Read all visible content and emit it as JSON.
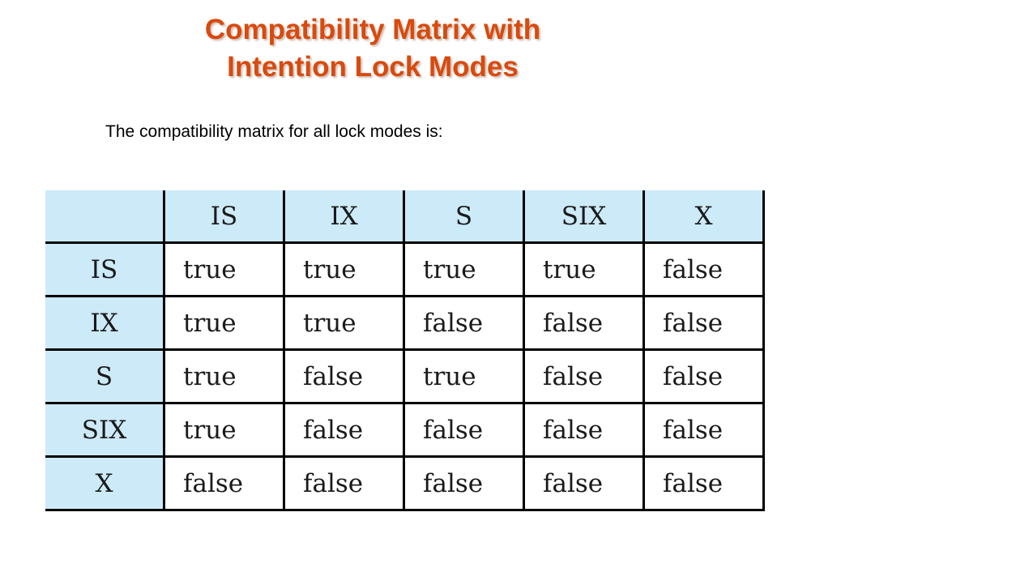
{
  "title": {
    "line1": "Compatibility Matrix with",
    "line2": "Intention Lock Modes"
  },
  "intro": "The compatibility matrix for all lock modes is:",
  "matrix": {
    "columns": [
      "IS",
      "IX",
      "S",
      "SIX",
      "X"
    ],
    "rows": [
      {
        "label": "IS",
        "cells": [
          "true",
          "true",
          "true",
          "true",
          "false"
        ]
      },
      {
        "label": "IX",
        "cells": [
          "true",
          "true",
          "false",
          "false",
          "false"
        ]
      },
      {
        "label": "S",
        "cells": [
          "true",
          "false",
          "true",
          "false",
          "false"
        ]
      },
      {
        "label": "SIX",
        "cells": [
          "true",
          "false",
          "false",
          "false",
          "false"
        ]
      },
      {
        "label": "X",
        "cells": [
          "false",
          "false",
          "false",
          "false",
          "false"
        ]
      }
    ]
  },
  "colors": {
    "title": "#d84a0e",
    "header_fill": "#cdeaf8"
  }
}
